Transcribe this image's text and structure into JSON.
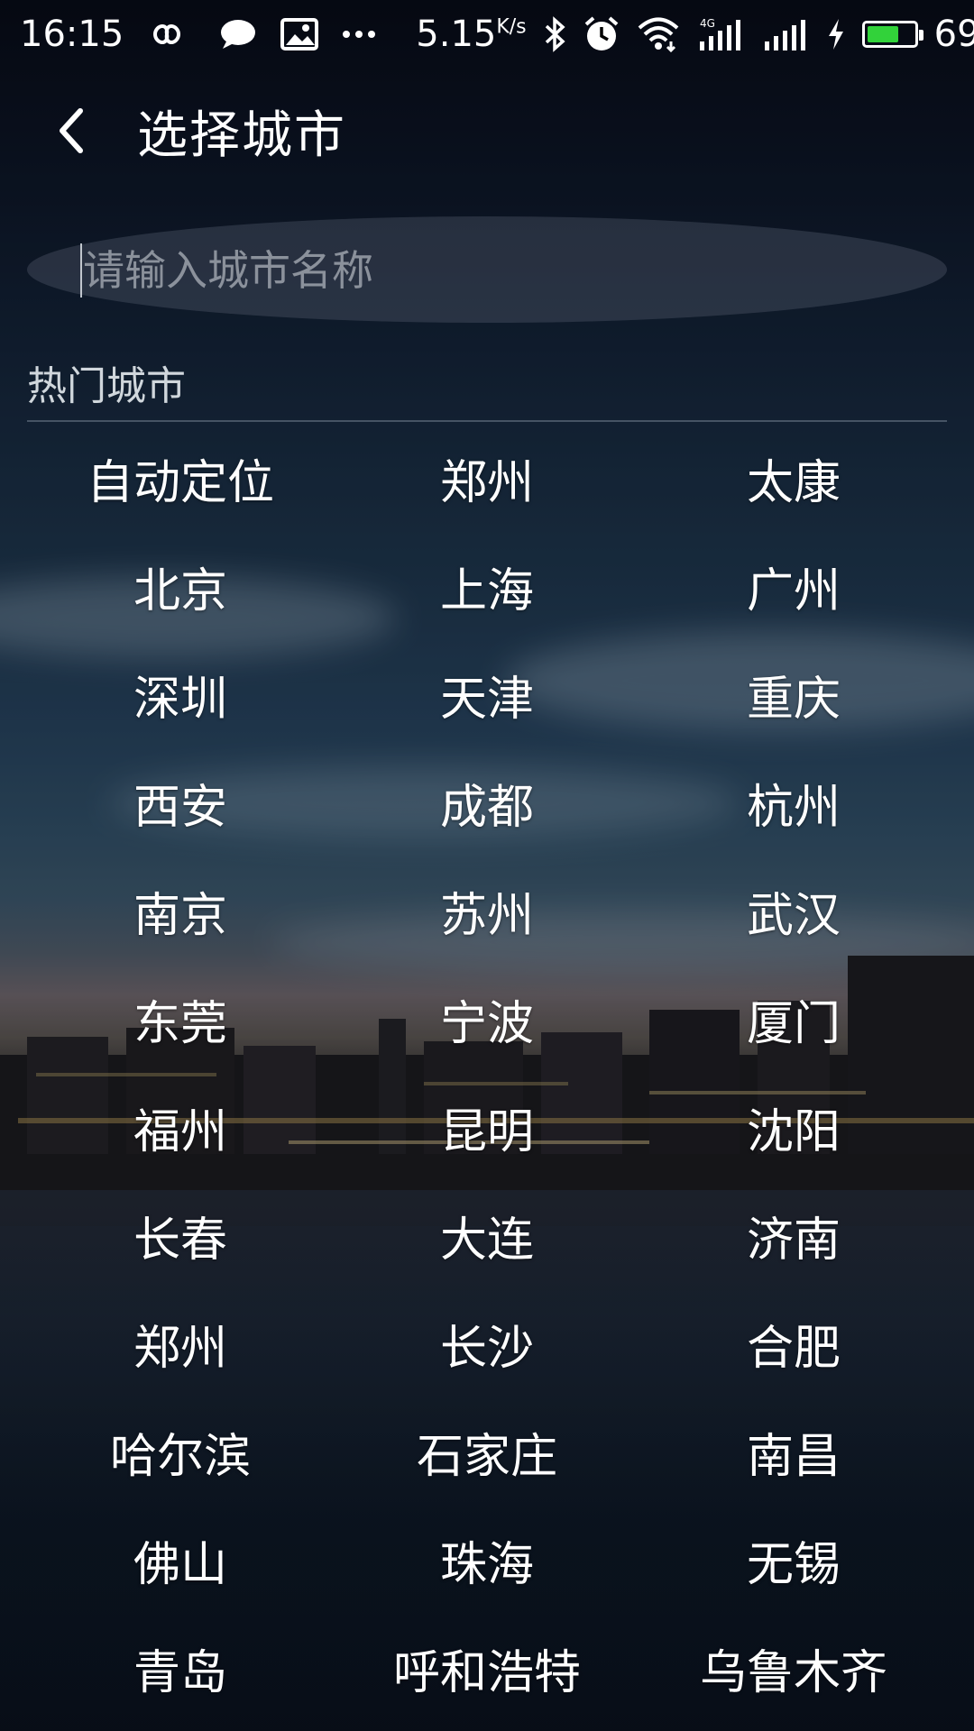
{
  "status_bar": {
    "time": "16:15",
    "net_speed_value": "5.15",
    "net_speed_unit": "K/s",
    "battery_level": "69",
    "battery_fraction": 0.69,
    "battery_color": "#32d23a",
    "icons": [
      "infinity-icon",
      "chat-bubble-icon",
      "image-icon",
      "more-dots-icon",
      "bluetooth-icon",
      "alarm-icon",
      "wifi-icon",
      "signal-4g-icon",
      "signal-icon",
      "charging-icon",
      "battery-icon"
    ]
  },
  "header": {
    "back_icon": "chevron-left-icon",
    "title": "选择城市"
  },
  "search": {
    "placeholder": "请输入城市名称",
    "value": ""
  },
  "section": {
    "title": "热门城市"
  },
  "cities": [
    "自动定位",
    "郑州",
    "太康",
    "北京",
    "上海",
    "广州",
    "深圳",
    "天津",
    "重庆",
    "西安",
    "成都",
    "杭州",
    "南京",
    "苏州",
    "武汉",
    "东莞",
    "宁波",
    "厦门",
    "福州",
    "昆明",
    "沈阳",
    "长春",
    "大连",
    "济南",
    "郑州",
    "长沙",
    "合肥",
    "哈尔滨",
    "石家庄",
    "南昌",
    "佛山",
    "珠海",
    "无锡",
    "青岛",
    "呼和浩特",
    "乌鲁木齐"
  ]
}
